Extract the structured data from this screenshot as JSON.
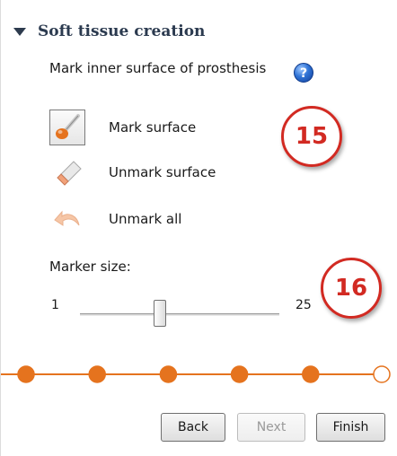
{
  "section": {
    "title": "Soft tissue creation"
  },
  "instruction": "Mark inner surface of prosthesis",
  "help": {
    "icon": "help-icon",
    "glyph": "?"
  },
  "tools": [
    {
      "label": "Mark surface",
      "icon": "brush-icon",
      "selected": true
    },
    {
      "label": "Unmark surface",
      "icon": "eraser-icon",
      "selected": false
    },
    {
      "label": "Unmark all",
      "icon": "undo-arrow-icon",
      "selected": false
    }
  ],
  "callouts": [
    "15",
    "16"
  ],
  "marker": {
    "label": "Marker size:",
    "min": "1",
    "max": "25",
    "value_fraction": 0.4
  },
  "progress": {
    "total_steps": 6,
    "current_step": 6,
    "color": "#e5731e"
  },
  "buttons": {
    "back": "Back",
    "next": "Next",
    "finish": "Finish"
  },
  "colors": {
    "accent": "#e5731e",
    "callout": "#d22a22",
    "header_text": "#2b3a4f"
  }
}
